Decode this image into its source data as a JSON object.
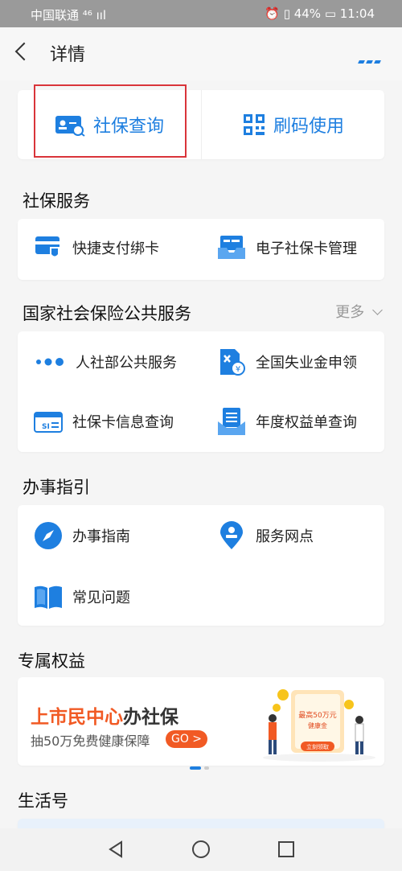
{
  "status": {
    "carrier": "中国联通 ⁴⁶ ııl",
    "right": "⏰ ▯ 44% ▭ 11:04"
  },
  "header": {
    "title": "详情"
  },
  "quick": {
    "left_label": "社保查询",
    "right_label": "刷码使用"
  },
  "social_service": {
    "title": "社保服务",
    "items": [
      {
        "label": "快捷支付绑卡"
      },
      {
        "label": "电子社保卡管理"
      }
    ]
  },
  "national": {
    "title": "国家社会保险公共服务",
    "more": "更多",
    "items": [
      {
        "label": "人社部公共服务"
      },
      {
        "label": "全国失业金申领"
      },
      {
        "label": "社保卡信息查询"
      },
      {
        "label": "年度权益单查询"
      }
    ]
  },
  "guide": {
    "title": "办事指引",
    "items": [
      {
        "label": "办事指南"
      },
      {
        "label": "服务网点"
      },
      {
        "label": "常见问题"
      }
    ]
  },
  "exclusive": {
    "title": "专属权益",
    "banner": {
      "title_highlight": "上市民中心",
      "title_rest": "办社保",
      "subtitle": "抽50万免费健康保障",
      "go": "GO >",
      "card_text": "最高50万元",
      "card_sub": "健康金",
      "card_button": "立刻领取"
    }
  },
  "life": {
    "title": "生活号"
  },
  "colors": {
    "accent": "#1e7fe0",
    "orange": "#f15a24",
    "highlight_box": "#d9343a"
  }
}
